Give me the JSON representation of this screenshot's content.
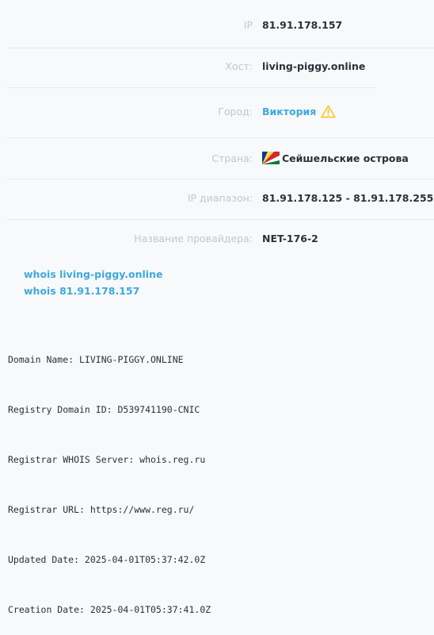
{
  "info": {
    "ip": {
      "label": "IP",
      "value": "81.91.178.157"
    },
    "host": {
      "label": "Хост:",
      "value": "living-piggy.online"
    },
    "city": {
      "label": "Город:",
      "value": "Виктория",
      "icon": "warning-icon"
    },
    "country": {
      "label": "Страна:",
      "value": "Сейшельские острова",
      "icon": "seychelles-flag-icon"
    },
    "ip_range": {
      "label": "IP диапазон:",
      "value": "81.91.178.125 - 81.91.178.255"
    },
    "provider": {
      "label": "Название провайдера:",
      "value": "NET-176-2"
    }
  },
  "whois_links": [
    "whois living-piggy.online",
    "whois 81.91.178.157"
  ],
  "whois_lines": [
    "Domain Name: LIVING-PIGGY.ONLINE",
    "Registry Domain ID: D539741190-CNIC",
    "Registrar WHOIS Server: whois.reg.ru",
    "Registrar URL: https://www.reg.ru/",
    "Updated Date: 2025-04-01T05:37:42.0Z",
    "Creation Date: 2025-04-01T05:37:41.0Z"
  ],
  "colors": {
    "label": "#c3c6ca",
    "value": "#2c3038",
    "link": "#3fa8de",
    "warning": "#f5c518",
    "background": "#f8f9fa"
  }
}
